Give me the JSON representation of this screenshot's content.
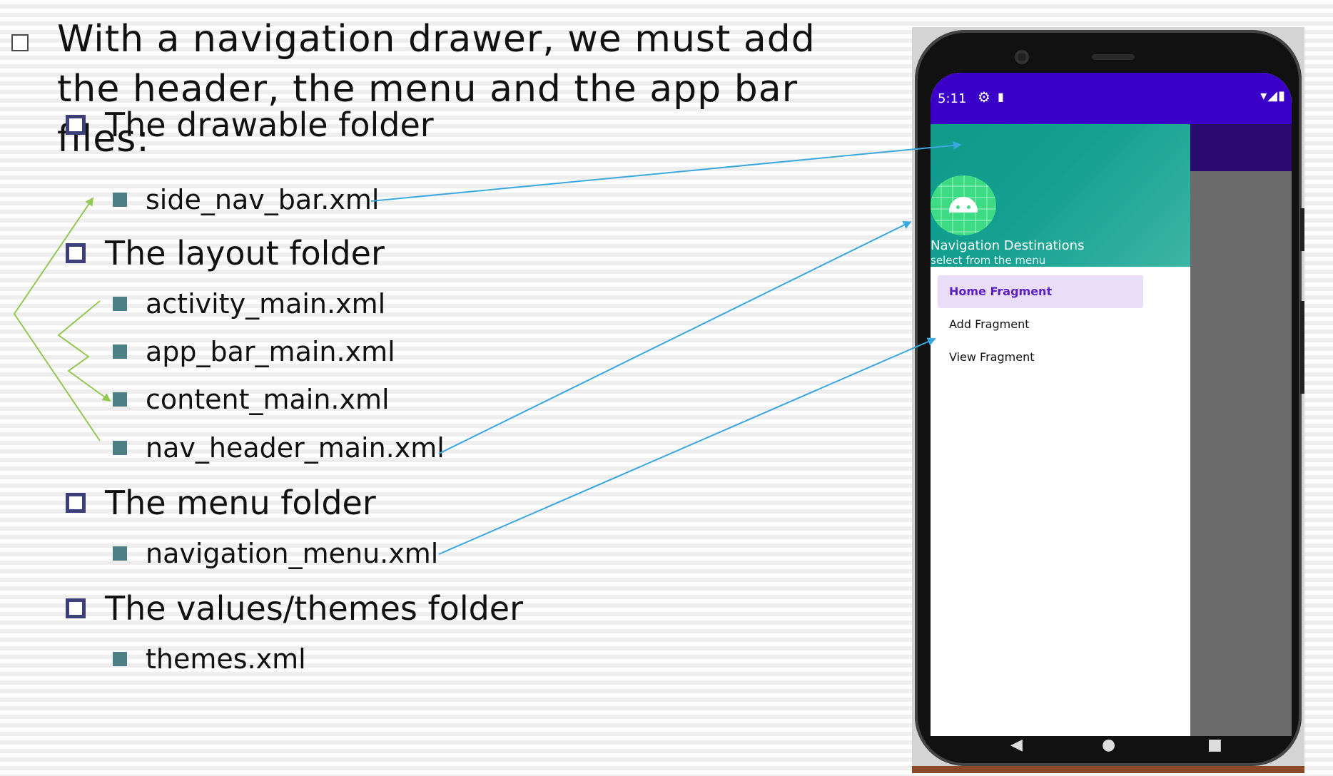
{
  "slide": {
    "main_bullet_text": "With a navigation drawer, we must add the header, the menu and the app bar files:",
    "sections": [
      {
        "title": "The drawable folder",
        "files": [
          "side_nav_bar.xml"
        ]
      },
      {
        "title": "The layout folder",
        "files": [
          "activity_main.xml",
          "app_bar_main.xml",
          "content_main.xml",
          "nav_header_main.xml"
        ]
      },
      {
        "title": "The menu folder",
        "files": [
          "navigation_menu.xml"
        ]
      },
      {
        "title": "The values/themes folder",
        "files": [
          "themes.xml"
        ]
      }
    ]
  },
  "phone": {
    "status_time": "5:11",
    "status_gear_icon": "⚙",
    "status_sd_icon": "▮",
    "status_right_icons": "▾◢▮",
    "header_title": "Navigation Destinations",
    "header_subtitle": "select from the menu",
    "menu": [
      "Home Fragment",
      "Add Fragment",
      "View Fragment"
    ],
    "selected_menu_index": 0,
    "nav_back": "◀",
    "nav_home": "●",
    "nav_recents": "■"
  },
  "colors": {
    "status_bar": "#3b00c8",
    "header_teal": "#14a090",
    "selected_item_bg": "#e9ddf8",
    "selected_item_text": "#5a1fc6",
    "arrow_blue": "#3aa7e0",
    "arrow_green": "#92c851",
    "bullet_l2": "#3d3f78",
    "bullet_l3": "#4d7f87"
  }
}
